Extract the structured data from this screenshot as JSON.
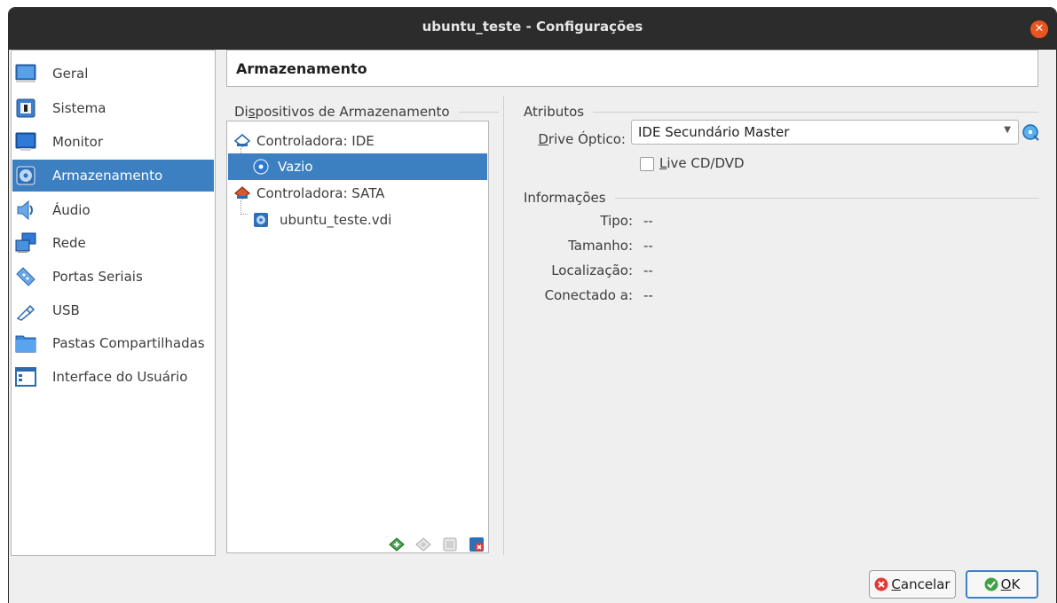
{
  "window": {
    "title": "ubuntu_teste - Configurações"
  },
  "sidebar": {
    "items": [
      {
        "label": "Geral",
        "icon": "general-icon"
      },
      {
        "label": "Sistema",
        "icon": "system-icon"
      },
      {
        "label": "Monitor",
        "icon": "display-icon"
      },
      {
        "label": "Armazenamento",
        "icon": "storage-icon",
        "selected": true
      },
      {
        "label": "Áudio",
        "icon": "audio-icon"
      },
      {
        "label": "Rede",
        "icon": "network-icon"
      },
      {
        "label": "Portas Seriais",
        "icon": "serial-ports-icon"
      },
      {
        "label": "USB",
        "icon": "usb-icon"
      },
      {
        "label": "Pastas Compartilhadas",
        "icon": "shared-folders-icon"
      },
      {
        "label": "Interface do Usuário",
        "icon": "user-interface-icon"
      }
    ]
  },
  "page": {
    "title": "Armazenamento"
  },
  "storage": {
    "header_prefix": "Di",
    "header_mnemonic": "s",
    "header_rest": "positivos de Armazenamento",
    "tree": [
      {
        "label": "Controladora: IDE",
        "icon": "ide-controller-icon"
      },
      {
        "label": "Vazio",
        "icon": "optical-disc-icon",
        "selected": true
      },
      {
        "label": "Controladora: SATA",
        "icon": "sata-controller-icon"
      },
      {
        "label": "ubuntu_teste.vdi",
        "icon": "hard-disk-icon"
      }
    ],
    "toolbar": [
      "add-controller-icon",
      "add-attachment-icon",
      "remove-attachment-icon",
      "remove-controller-icon"
    ]
  },
  "attributes": {
    "header": "Atributos",
    "drive_label_mnemonic": "D",
    "drive_label_rest": "rive Óptico:",
    "drive_value": "IDE Secundário Master",
    "live_mnemonic": "L",
    "live_rest": "ive CD/DVD",
    "live_checked": false
  },
  "info": {
    "header": "Informações",
    "rows": [
      {
        "label": "Tipo:",
        "value": "--"
      },
      {
        "label": "Tamanho:",
        "value": "--"
      },
      {
        "label": "Localização:",
        "value": "--"
      },
      {
        "label": "Conectado a:",
        "value": "--"
      }
    ]
  },
  "buttons": {
    "cancel_mnemonic": "C",
    "cancel_rest": "ancelar",
    "ok_mnemonic": "O",
    "ok_rest": "K"
  },
  "colors": {
    "selection": "#3d80c2",
    "titlebar": "#2c2c2c",
    "close": "#e9541f"
  }
}
